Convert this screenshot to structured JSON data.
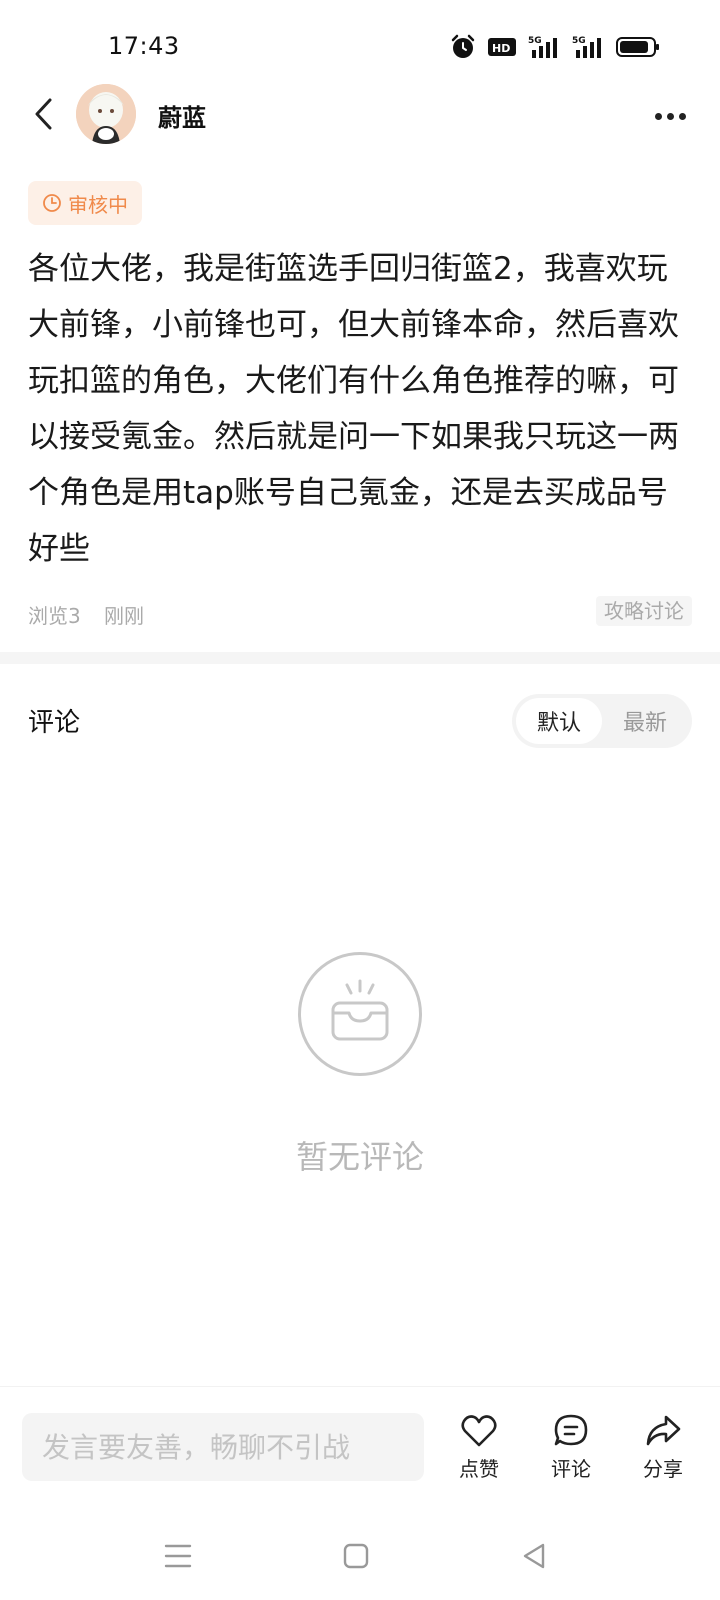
{
  "status_bar": {
    "time": "17:43",
    "icons": [
      "alarm-icon",
      "hd-icon",
      "signal-5g-icon",
      "signal-5g-icon",
      "battery-icon"
    ]
  },
  "header": {
    "back_icon": "chevron-left-icon",
    "username": "蔚蓝",
    "more_icon": "more-dots-icon"
  },
  "post": {
    "status_badge": "审核中",
    "body": "各位大佬，我是街篮选手回归街篮2，我喜欢玩大前锋，小前锋也可，但大前锋本命，然后喜欢玩扣篮的角色，大佬们有什么角色推荐的嘛，可以接受氪金。然后就是问一下如果我只玩这一两个角色是用tap账号自己氪金，还是去买成品号好些",
    "views": "浏览3",
    "time": "刚刚",
    "tag": "攻略讨论"
  },
  "comments": {
    "title": "评论",
    "sort_options": [
      "默认",
      "最新"
    ],
    "sort_selected": "默认",
    "empty_text": "暂无评论"
  },
  "bottom_bar": {
    "input_placeholder": "发言要友善，畅聊不引战",
    "like_label": "点赞",
    "comment_label": "评论",
    "share_label": "分享"
  },
  "colors": {
    "accent_orange": "#f08a4b",
    "badge_bg": "#fdf0e7",
    "muted_text": "#aaaaaa"
  }
}
